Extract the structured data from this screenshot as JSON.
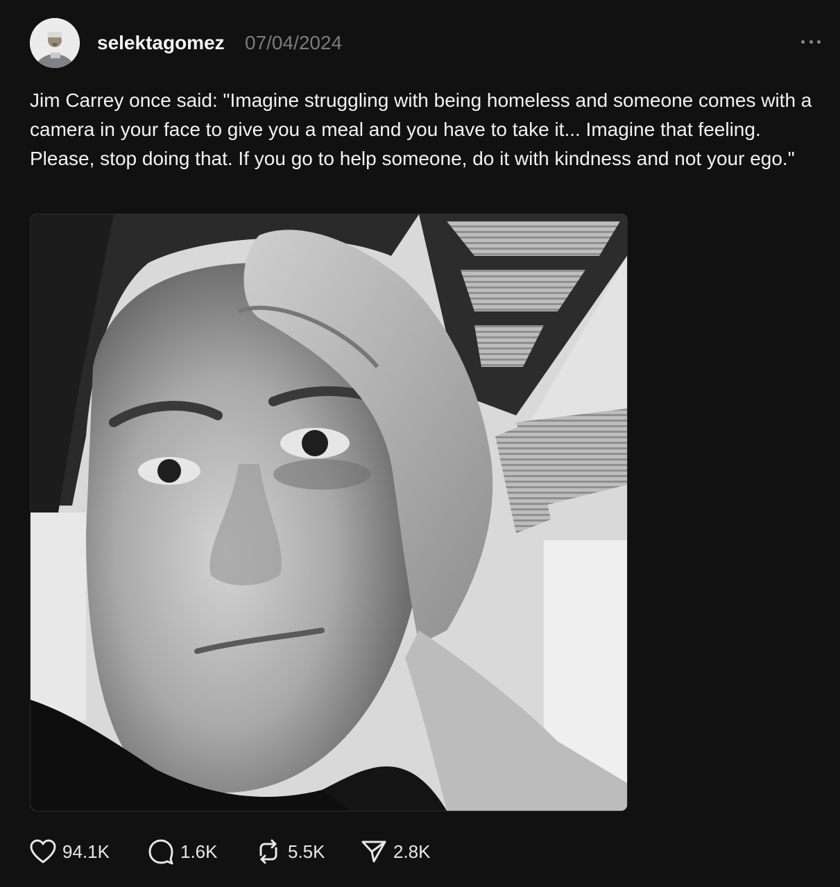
{
  "post": {
    "username": "selektagomez",
    "timestamp": "07/04/2024",
    "caption": "Jim Carrey once said: \"Imagine struggling with being homeless and someone comes with a camera in your face to give you a meal and you have to take it... Imagine that feeling. Please, stop doing that. If you go to help someone, do it with kindness and not your ego.\"",
    "actions": {
      "likes": "94.1K",
      "replies": "1.6K",
      "reposts": "5.5K",
      "shares": "2.8K"
    }
  },
  "icons": {
    "like": "heart-icon",
    "reply": "speech-bubble-icon",
    "repost": "repost-arrows-icon",
    "share": "send-icon",
    "more": "more-options-icon"
  },
  "colors": {
    "background": "#111111",
    "text": "#f3f3f3",
    "muted": "#7b7b7b"
  }
}
